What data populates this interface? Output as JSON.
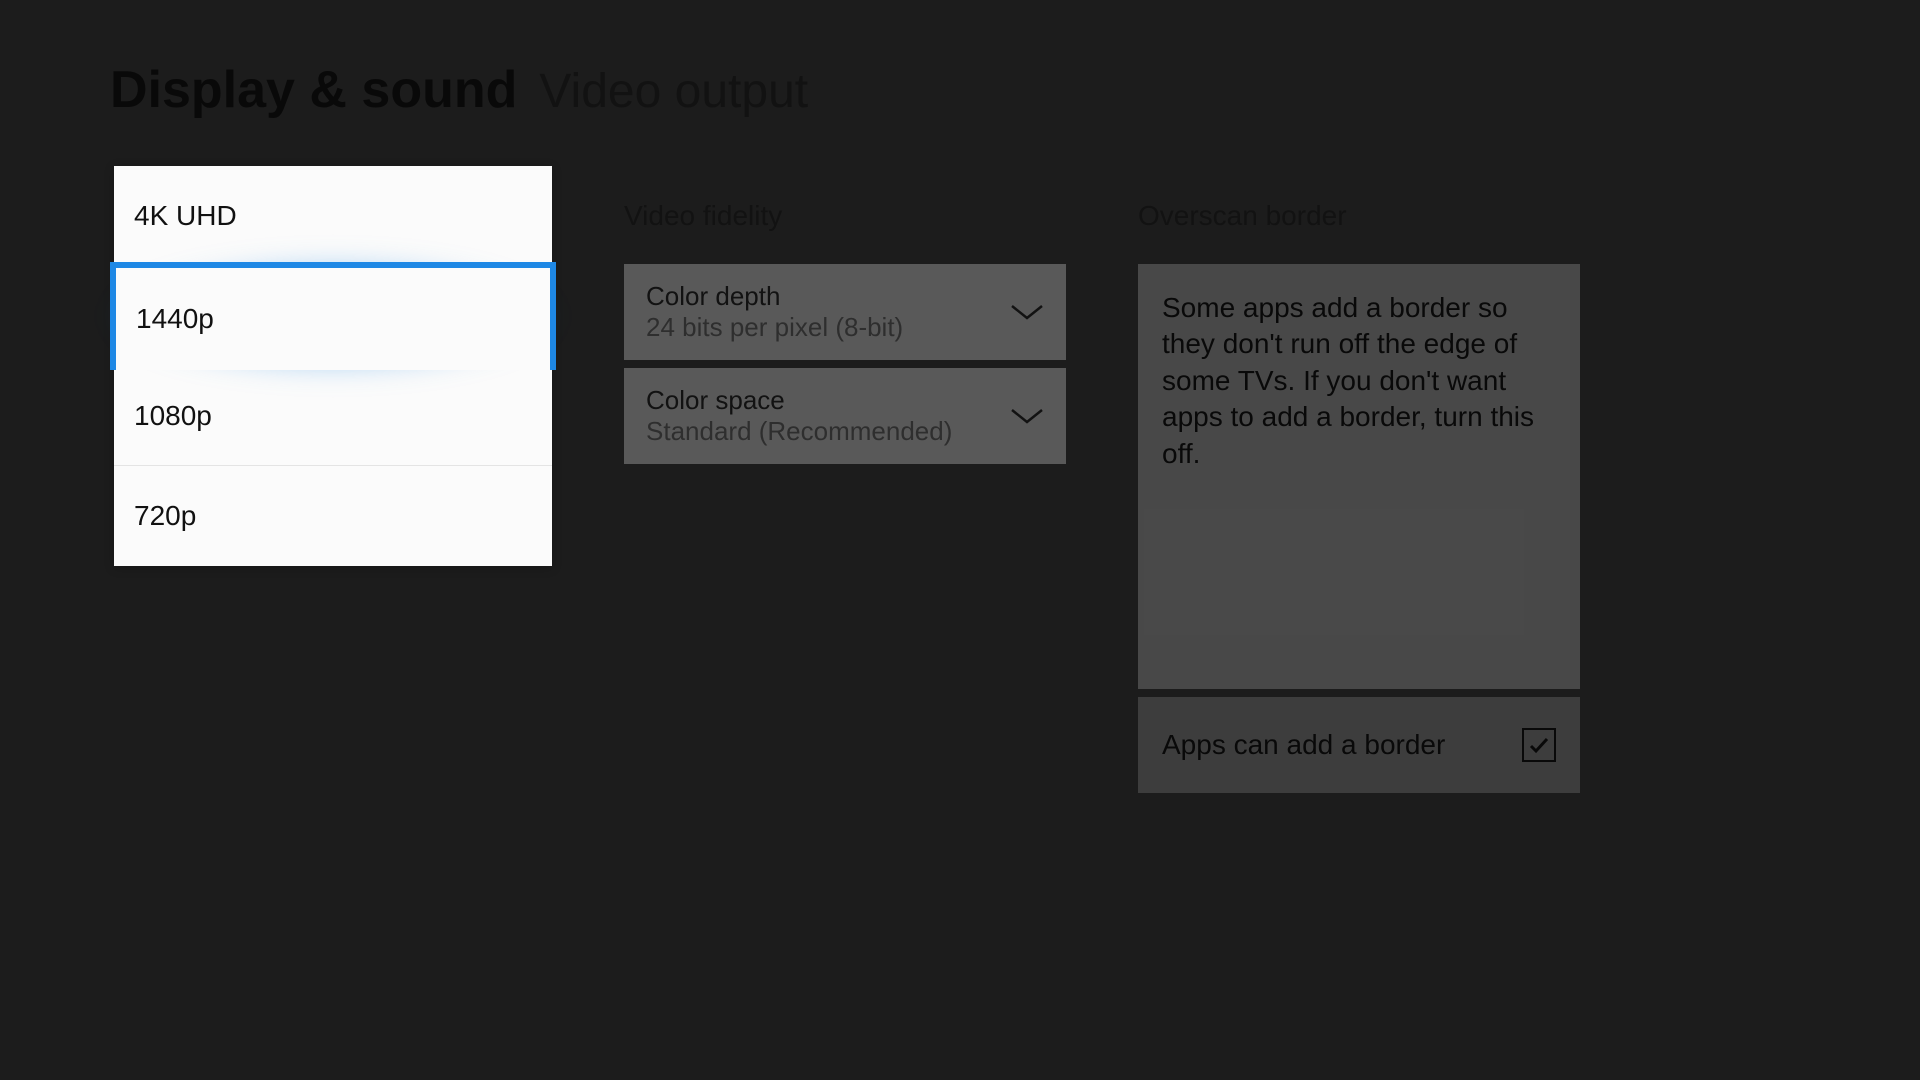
{
  "header": {
    "section": "Display & sound",
    "page": "Video output"
  },
  "resolution_options": [
    {
      "label": "4K UHD",
      "selected": false
    },
    {
      "label": "1440p",
      "selected": true
    },
    {
      "label": "1080p",
      "selected": false
    },
    {
      "label": "720p",
      "selected": false
    }
  ],
  "video_fidelity": {
    "title": "Video fidelity",
    "color_depth": {
      "label": "Color depth",
      "value": "24 bits per pixel (8-bit)"
    },
    "color_space": {
      "label": "Color space",
      "value": "Standard (Recommended)"
    }
  },
  "overscan": {
    "title": "Overscan border",
    "description": "Some apps add a border so they don't run off the edge of some TVs. If you don't want apps to add a border, turn this off.",
    "checkbox": {
      "label": "Apps can add a border",
      "checked": true
    }
  }
}
